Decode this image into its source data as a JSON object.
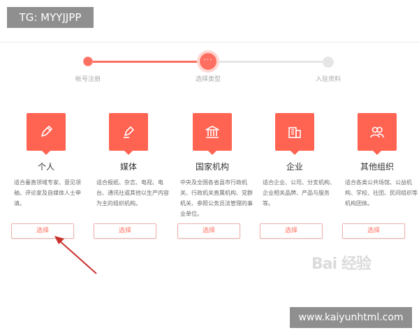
{
  "overlay": {
    "tag": "TG: MYYJJPP",
    "url": "www.kaiyunhtml.com"
  },
  "stepper": {
    "steps": [
      {
        "label": "帐号注册",
        "state": "done"
      },
      {
        "label": "选择类型",
        "state": "current",
        "marker": "···"
      },
      {
        "label": "入驻资料",
        "state": "todo"
      }
    ]
  },
  "colors": {
    "accent": "#ff6352",
    "track_inactive": "#e6e6e6"
  },
  "cards": [
    {
      "title": "个人",
      "icon": "pencil-icon",
      "desc": "适合垂直领域专家、意见领袖、评论家及自媒体人士申请。",
      "button": "选择"
    },
    {
      "title": "媒体",
      "icon": "pen-icon",
      "desc": "适合报纸、杂志、电视、电台、通讯社或其他以生产内容为主的组织机构。",
      "button": "选择"
    },
    {
      "title": "国家机构",
      "icon": "government-building-icon",
      "desc": "中央及全国各省县市行政机关、行政机关直属机构、党群机关、参照公务员法管理的事业单位。",
      "button": "选择"
    },
    {
      "title": "企业",
      "icon": "office-building-icon",
      "desc": "适合企业、公司、分支机构、企业相关品牌、产品与服务等。",
      "button": "选择"
    },
    {
      "title": "其他组织",
      "icon": "group-users-icon",
      "desc": "适合各类公共场馆、公益机构、学校、社团、民间组织等机构团体。",
      "button": "选择"
    }
  ],
  "watermark": {
    "text": "Bai 经验"
  }
}
